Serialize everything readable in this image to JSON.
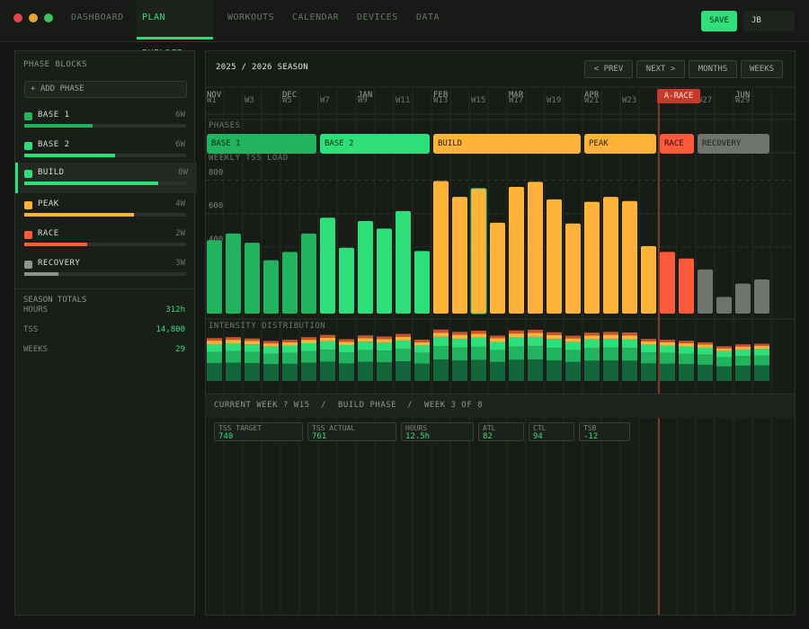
{
  "nav": {
    "tabs": [
      "DASHBOARD",
      "PLAN BUILDER",
      "WORKOUTS",
      "CALENDAR",
      "DEVICES",
      "DATA"
    ],
    "save_label": "SAVE",
    "user_initials": "JB"
  },
  "sidebar": {
    "header": "PHASE BLOCKS",
    "add_label": "+ ADD PHASE",
    "phases": [
      {
        "name": "BASE 1",
        "weeks": "6W",
        "color": "#22b35e",
        "progress": 0.42
      },
      {
        "name": "BASE 2",
        "weeks": "6W",
        "color": "#2fe07a",
        "progress": 0.56
      },
      {
        "name": "BUILD",
        "weeks": "8W",
        "color": "#2fe07a",
        "progress": 0.83
      },
      {
        "name": "PEAK",
        "weeks": "4W",
        "color": "#ffb338",
        "progress": 0.68
      },
      {
        "name": "RACE",
        "weeks": "2W",
        "color": "#ff5a3c",
        "progress": 0.39
      },
      {
        "name": "RECOVERY",
        "weeks": "3W",
        "color": "#8e948c",
        "progress": 0.21
      }
    ],
    "totals": {
      "header": "SEASON TOTALS",
      "hours_label": "HOURS",
      "hours": "312h",
      "tss_label": "TSS",
      "tss": "14,800",
      "weeks_label": "WEEKS",
      "weeks": "29"
    }
  },
  "main": {
    "season_title": "2025 / 2026  SEASON",
    "prev_label": "< PREV",
    "next_label": "NEXT >",
    "months_label": "MONTHS",
    "weeks_label": "WEEKS",
    "phases_label": "PHASES",
    "tss_label": "WEEKLY TSS LOAD",
    "intensity_label": "INTENSITY DISTRIBUTION",
    "race_marker": "A-RACE",
    "months": [
      "NOV",
      "DEC",
      "JAN",
      "FEB",
      "MAR",
      "APR",
      "JUN"
    ],
    "week_labels": [
      "W1",
      "W3",
      "W5",
      "W7",
      "W9",
      "W11",
      "W13",
      "W15",
      "W17",
      "W19",
      "W21",
      "W23",
      "W27",
      "W29"
    ],
    "phase_bars": [
      {
        "name": "BASE 1",
        "color": "#22b35e",
        "text": "#0d2a16"
      },
      {
        "name": "BASE 2",
        "color": "#2fe07a",
        "text": "#0d2a16"
      },
      {
        "name": "BUILD",
        "color": "#ffb338",
        "text": "#2a1a05"
      },
      {
        "name": "PEAK",
        "color": "#ffb338",
        "text": "#2a1a05"
      },
      {
        "name": "RACE",
        "color": "#ff5a3c",
        "text": "#2a0a05"
      },
      {
        "name": "RECOVERY",
        "color": "#6f756d",
        "text": "#1a1d19"
      }
    ],
    "footer": {
      "current_week": "CURRENT WEEK ? W15",
      "phase": "BUILD PHASE",
      "week_of": "WEEK 3 OF 8"
    },
    "stats": [
      {
        "label": "TSS TARGET",
        "value": "740"
      },
      {
        "label": "TSS ACTUAL",
        "value": "761"
      },
      {
        "label": "HOURS",
        "value": "12.5h"
      },
      {
        "label": "ATL",
        "value": "82"
      },
      {
        "label": "CTL",
        "value": "94"
      },
      {
        "label": "TSB",
        "value": "-12"
      }
    ]
  },
  "chart_data": {
    "type": "bar",
    "title": "WEEKLY TSS LOAD",
    "y_ticks": [
      "800",
      "600",
      "400"
    ],
    "ylim": [
      0,
      900
    ],
    "current_week_index": 14,
    "values": [
      440,
      480,
      425,
      320,
      370,
      480,
      575,
      395,
      555,
      510,
      615,
      375,
      795,
      700,
      750,
      545,
      760,
      790,
      685,
      540,
      670,
      700,
      675,
      405,
      370,
      330,
      265,
      100,
      180,
      205
    ],
    "colors": [
      "#22b35e",
      "#22b35e",
      "#22b35e",
      "#22b35e",
      "#22b35e",
      "#22b35e",
      "#2fe07a",
      "#2fe07a",
      "#2fe07a",
      "#2fe07a",
      "#2fe07a",
      "#2fe07a",
      "#ffb338",
      "#ffb338",
      "#ffb338",
      "#ffb338",
      "#ffb338",
      "#ffb338",
      "#ffb338",
      "#ffb338",
      "#ffb338",
      "#ffb338",
      "#ffb338",
      "#ffb338",
      "#ff5a3c",
      "#ff5a3c",
      "#6f756d",
      "#6f756d",
      "#6f756d",
      "#6f756d"
    ]
  }
}
